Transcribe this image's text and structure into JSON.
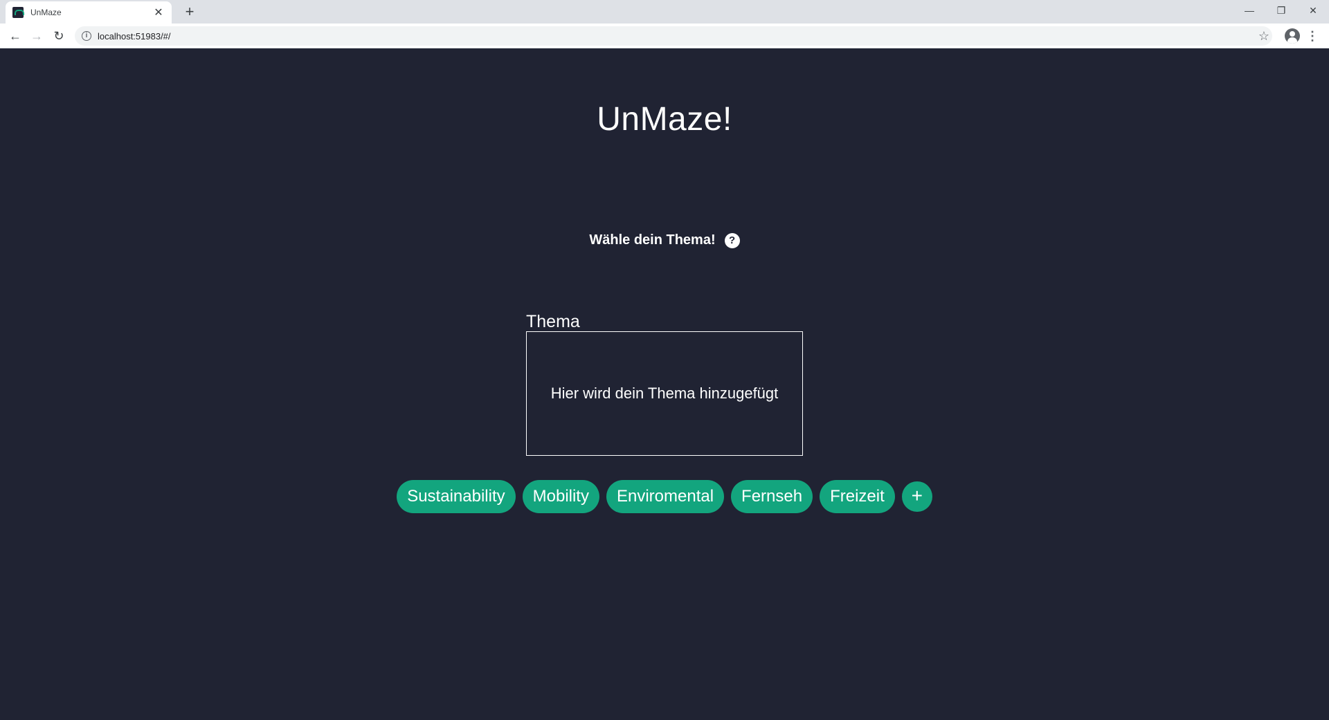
{
  "browser": {
    "tab_title": "UnMaze",
    "tab_close": "✕",
    "new_tab": "+",
    "url": "localhost:51983/#/",
    "window_minimize": "—",
    "window_restore": "❐",
    "window_close": "✕"
  },
  "app": {
    "title": "UnMaze!"
  },
  "prompt": {
    "text": "Wähle dein Thema!",
    "help_icon": "?"
  },
  "topic": {
    "label": "Thema",
    "placeholder": "Hier wird dein Thema hinzugefügt"
  },
  "chips": [
    "Sustainability",
    "Mobility",
    "Enviromental",
    "Fernseh",
    "Freizeit"
  ],
  "add_chip_label": "+",
  "colors": {
    "background": "#202333",
    "accent": "#13a57e",
    "text": "#ffffff"
  }
}
